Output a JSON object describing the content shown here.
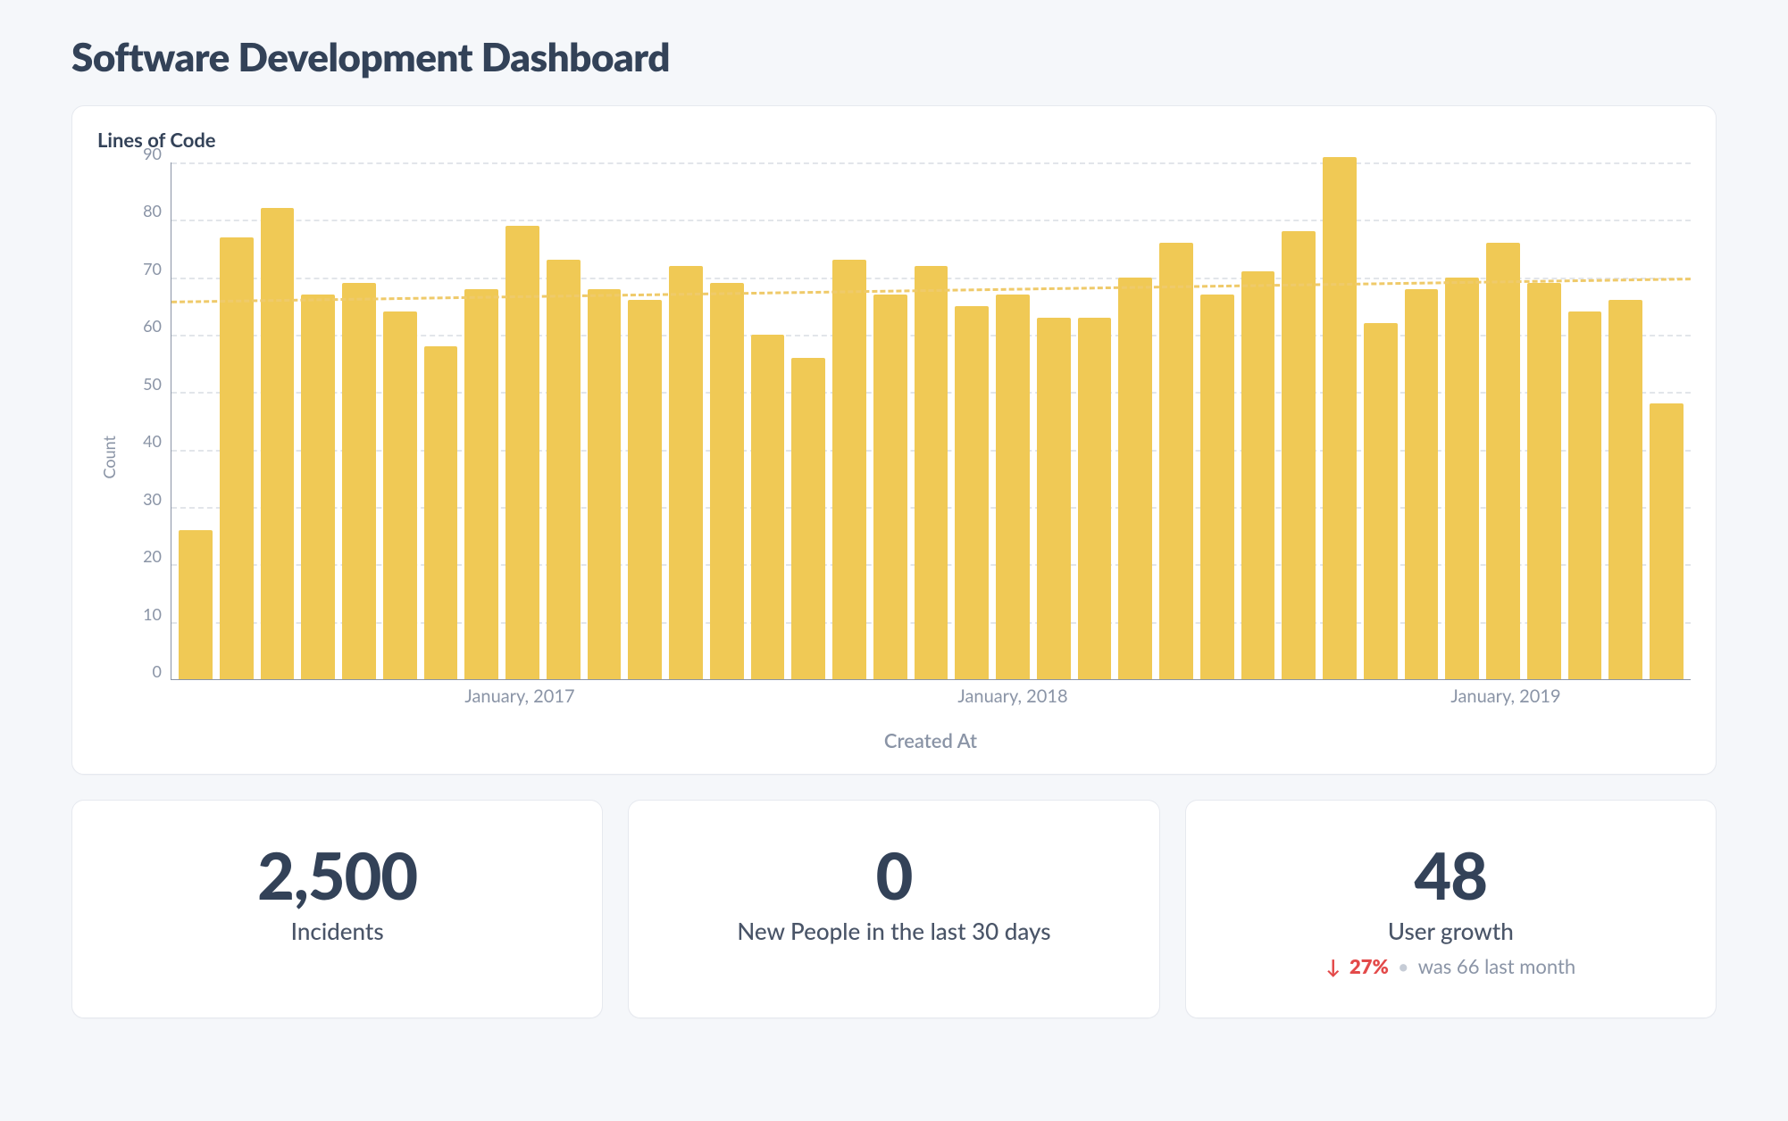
{
  "page": {
    "title": "Software Development Dashboard"
  },
  "chart": {
    "title": "Lines of Code",
    "xlabel": "Created At"
  },
  "chart_data": {
    "type": "bar",
    "title": "Lines of Code",
    "xlabel": "Created At",
    "ylabel": "Count",
    "ylim": [
      0,
      90
    ],
    "yticks": [
      0,
      10,
      20,
      30,
      40,
      50,
      60,
      70,
      80,
      90
    ],
    "xticks": [
      {
        "index": 8,
        "label": "January, 2017"
      },
      {
        "index": 20,
        "label": "January, 2018"
      },
      {
        "index": 32,
        "label": "January, 2019"
      }
    ],
    "values": [
      26,
      77,
      82,
      67,
      69,
      64,
      58,
      68,
      79,
      73,
      68,
      66,
      72,
      69,
      60,
      56,
      73,
      67,
      72,
      65,
      67,
      63,
      63,
      70,
      76,
      67,
      71,
      78,
      91,
      62,
      68,
      70,
      76,
      69,
      64,
      66,
      48
    ],
    "trend": [
      66,
      70
    ]
  },
  "tiles": [
    {
      "value": "2,500",
      "caption": "Incidents",
      "delta": null
    },
    {
      "value": "0",
      "caption": "New People in the last 30 days",
      "delta": null
    },
    {
      "value": "48",
      "caption": "User growth",
      "delta": {
        "direction": "down",
        "pct": "27%",
        "previous_label": "was 66",
        "period_label": "last month"
      }
    }
  ]
}
